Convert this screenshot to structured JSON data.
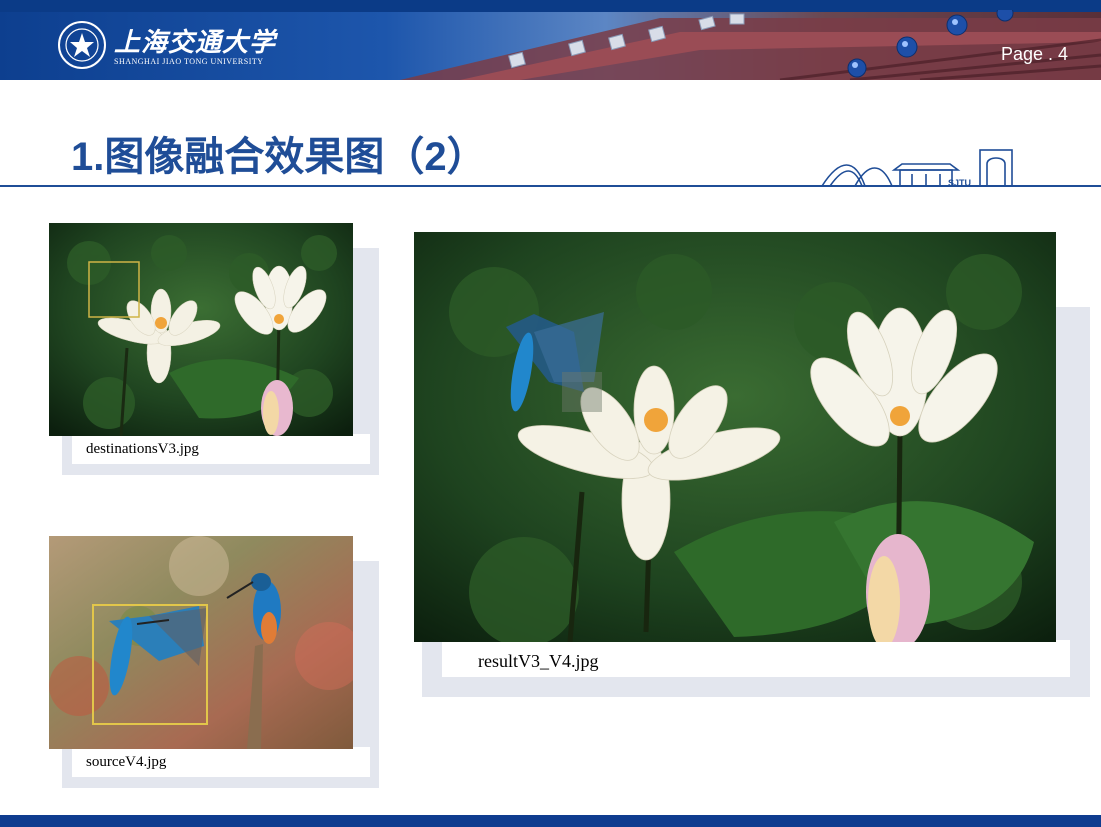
{
  "header": {
    "university_cn": "上海交通大学",
    "university_en": "SHANGHAI JIAO TONG UNIVERSITY",
    "page_label": "Page . 4"
  },
  "slide": {
    "title": "1.图像融合效果图（2）"
  },
  "images": {
    "destination": {
      "caption": "destinationsV3.jpg"
    },
    "source": {
      "caption": "sourceV4.jpg"
    },
    "result": {
      "caption": "resultV3_V4.jpg"
    }
  },
  "colors": {
    "brand_blue": "#1f4d97",
    "header_blue": "#0d3f8f",
    "frame_gray": "#e3e6ee",
    "selection_yellow": "#e2c64a"
  }
}
